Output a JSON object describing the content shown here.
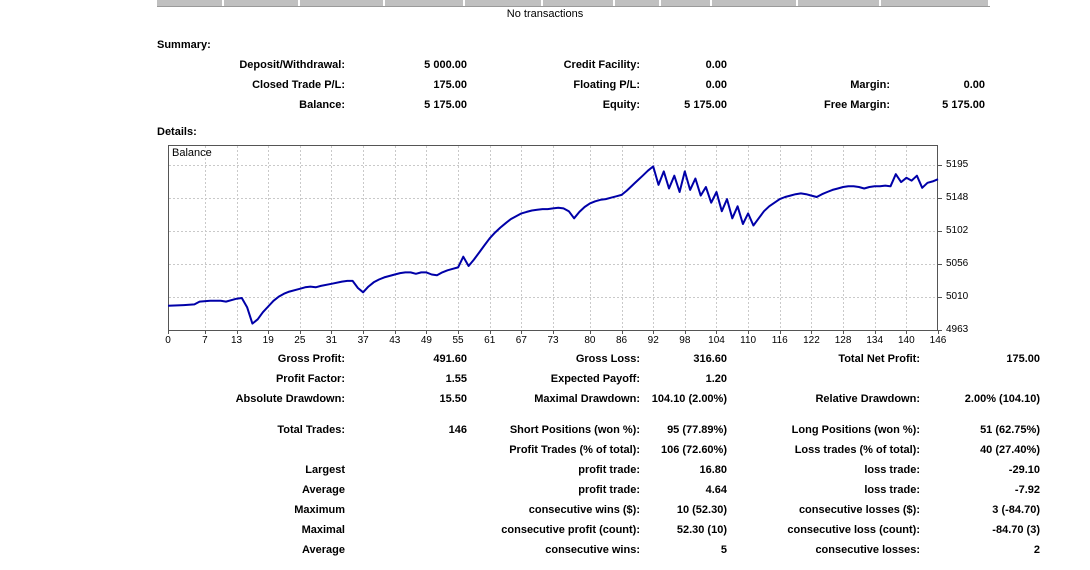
{
  "report": {
    "no_transactions": "No transactions",
    "summary_heading": "Summary:",
    "details_heading": "Details:"
  },
  "summary_rows": [
    [
      "Deposit/Withdrawal:",
      "5 000.00",
      "Credit Facility:",
      "0.00",
      "",
      ""
    ],
    [
      "Closed Trade P/L:",
      "175.00",
      "Floating P/L:",
      "0.00",
      "Margin:",
      "0.00"
    ],
    [
      "Balance:",
      "5 175.00",
      "Equity:",
      "5 175.00",
      "Free Margin:",
      "5 175.00"
    ]
  ],
  "stats_rows_a": [
    [
      "Gross Profit:",
      "491.60",
      "Gross Loss:",
      "316.60",
      "Total Net Profit:",
      "175.00"
    ],
    [
      "Profit Factor:",
      "1.55",
      "Expected Payoff:",
      "1.20",
      "",
      ""
    ],
    [
      "Absolute Drawdown:",
      "15.50",
      "Maximal Drawdown:",
      "104.10 (2.00%)",
      "Relative Drawdown:",
      "2.00% (104.10)"
    ]
  ],
  "stats_rows_b": [
    [
      "Total Trades:",
      "146",
      "Short Positions (won %):",
      "95 (77.89%)",
      "Long Positions (won %):",
      "51 (62.75%)"
    ],
    [
      "",
      "",
      "Profit Trades (% of total):",
      "106 (72.60%)",
      "Loss trades (% of total):",
      "40 (27.40%)"
    ]
  ],
  "stats_rows_c": [
    [
      "Largest",
      "",
      "profit trade:",
      "16.80",
      "loss trade:",
      "-29.10"
    ],
    [
      "Average",
      "",
      "profit trade:",
      "4.64",
      "loss trade:",
      "-7.92"
    ],
    [
      "Maximum",
      "",
      "consecutive wins ($):",
      "10 (52.30)",
      "consecutive losses ($):",
      "3 (-84.70)"
    ],
    [
      "Maximal",
      "",
      "consecutive profit (count):",
      "52.30 (10)",
      "consecutive loss (count):",
      "-84.70 (3)"
    ],
    [
      "Average",
      "",
      "consecutive wins:",
      "5",
      "consecutive losses:",
      "2"
    ]
  ],
  "chart_data": {
    "type": "line",
    "title": "Balance",
    "xlabel": "",
    "ylabel": "",
    "x_range": [
      0,
      146
    ],
    "ylim": [
      4963,
      5223
    ],
    "x_ticks": [
      0,
      7,
      13,
      19,
      25,
      31,
      37,
      43,
      49,
      55,
      61,
      67,
      73,
      80,
      86,
      92,
      98,
      104,
      110,
      116,
      122,
      128,
      134,
      140,
      146
    ],
    "y_ticks": [
      5195,
      5148,
      5102,
      5056,
      5010,
      4963
    ],
    "grid": "dashed",
    "grid_color": "#c9c9c9",
    "line_color": "#0000A8",
    "border_color": "#555555",
    "legend_position": "top-left",
    "series": [
      {
        "name": "Balance",
        "points": [
          [
            0,
            4997
          ],
          [
            3,
            4998
          ],
          [
            5,
            4999
          ],
          [
            6,
            5003
          ],
          [
            8,
            5004
          ],
          [
            10,
            5004
          ],
          [
            11,
            5003
          ],
          [
            13,
            5007
          ],
          [
            14,
            5008
          ],
          [
            15,
            4995
          ],
          [
            16,
            4972
          ],
          [
            17,
            4978
          ],
          [
            18,
            4988
          ],
          [
            19,
            4996
          ],
          [
            20,
            5004
          ],
          [
            21,
            5010
          ],
          [
            22,
            5014
          ],
          [
            23,
            5017
          ],
          [
            25,
            5021
          ],
          [
            26,
            5023
          ],
          [
            27,
            5024
          ],
          [
            28,
            5023
          ],
          [
            29,
            5025
          ],
          [
            31,
            5028
          ],
          [
            33,
            5031
          ],
          [
            34,
            5032
          ],
          [
            35,
            5032
          ],
          [
            36,
            5022
          ],
          [
            37,
            5016
          ],
          [
            38,
            5024
          ],
          [
            39,
            5030
          ],
          [
            40,
            5034
          ],
          [
            41,
            5037
          ],
          [
            43,
            5041
          ],
          [
            44,
            5043
          ],
          [
            45,
            5044
          ],
          [
            46,
            5044
          ],
          [
            47,
            5042
          ],
          [
            48,
            5044
          ],
          [
            49,
            5044
          ],
          [
            50,
            5041
          ],
          [
            51,
            5040
          ],
          [
            52,
            5044
          ],
          [
            53,
            5047
          ],
          [
            54,
            5049
          ],
          [
            55,
            5051
          ],
          [
            56,
            5066
          ],
          [
            57,
            5053
          ],
          [
            58,
            5062
          ],
          [
            59,
            5072
          ],
          [
            60,
            5082
          ],
          [
            61,
            5092
          ],
          [
            62,
            5100
          ],
          [
            63,
            5107
          ],
          [
            64,
            5113
          ],
          [
            65,
            5119
          ],
          [
            66,
            5123
          ],
          [
            67,
            5127
          ],
          [
            68,
            5129
          ],
          [
            69,
            5131
          ],
          [
            70,
            5132
          ],
          [
            71,
            5133
          ],
          [
            72,
            5133
          ],
          [
            73,
            5134
          ],
          [
            74,
            5135
          ],
          [
            75,
            5134
          ],
          [
            76,
            5130
          ],
          [
            77,
            5120
          ],
          [
            78,
            5129
          ],
          [
            79,
            5136
          ],
          [
            80,
            5141
          ],
          [
            81,
            5144
          ],
          [
            82,
            5146
          ],
          [
            83,
            5147
          ],
          [
            84,
            5149
          ],
          [
            85,
            5151
          ],
          [
            86,
            5153
          ],
          [
            87,
            5159
          ],
          [
            88,
            5166
          ],
          [
            89,
            5173
          ],
          [
            90,
            5180
          ],
          [
            91,
            5187
          ],
          [
            92,
            5193
          ],
          [
            93,
            5167
          ],
          [
            94,
            5186
          ],
          [
            95,
            5162
          ],
          [
            96,
            5180
          ],
          [
            97,
            5157
          ],
          [
            98,
            5186
          ],
          [
            99,
            5160
          ],
          [
            100,
            5176
          ],
          [
            101,
            5152
          ],
          [
            102,
            5164
          ],
          [
            103,
            5142
          ],
          [
            104,
            5157
          ],
          [
            105,
            5130
          ],
          [
            106,
            5147
          ],
          [
            107,
            5120
          ],
          [
            108,
            5137
          ],
          [
            109,
            5112
          ],
          [
            110,
            5127
          ],
          [
            111,
            5110
          ],
          [
            112,
            5120
          ],
          [
            113,
            5130
          ],
          [
            114,
            5137
          ],
          [
            115,
            5142
          ],
          [
            116,
            5147
          ],
          [
            117,
            5150
          ],
          [
            118,
            5152
          ],
          [
            119,
            5154
          ],
          [
            120,
            5155
          ],
          [
            121,
            5154
          ],
          [
            122,
            5152
          ],
          [
            123,
            5150
          ],
          [
            124,
            5154
          ],
          [
            125,
            5157
          ],
          [
            126,
            5160
          ],
          [
            127,
            5162
          ],
          [
            128,
            5164
          ],
          [
            129,
            5165
          ],
          [
            130,
            5165
          ],
          [
            131,
            5164
          ],
          [
            132,
            5162
          ],
          [
            133,
            5164
          ],
          [
            134,
            5165
          ],
          [
            135,
            5165
          ],
          [
            136,
            5166
          ],
          [
            137,
            5165
          ],
          [
            138,
            5182
          ],
          [
            139,
            5171
          ],
          [
            140,
            5177
          ],
          [
            141,
            5173
          ],
          [
            142,
            5180
          ],
          [
            143,
            5163
          ],
          [
            144,
            5170
          ],
          [
            145,
            5172
          ],
          [
            146,
            5175
          ]
        ]
      }
    ]
  }
}
